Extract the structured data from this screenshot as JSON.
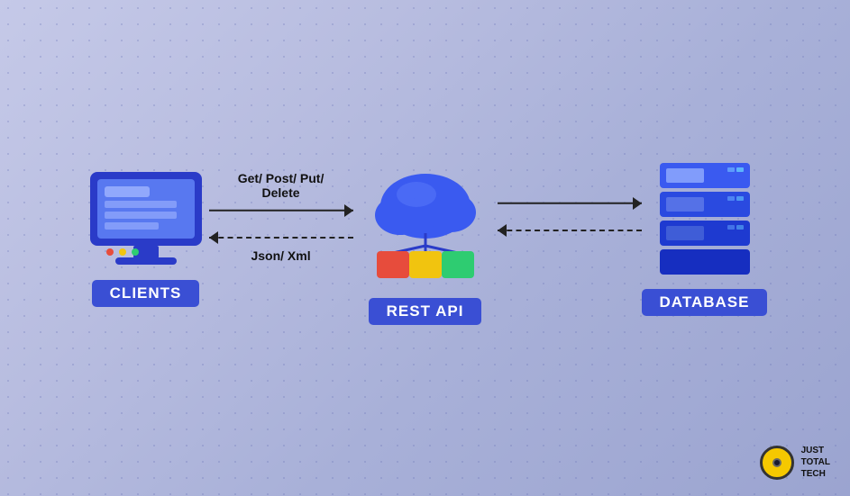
{
  "background": {
    "gradient_start": "#c5c9e8",
    "gradient_end": "#9ba4d0"
  },
  "diagram": {
    "clients": {
      "label": "CLIENTS"
    },
    "rest_api": {
      "label": "REST API"
    },
    "database": {
      "label": "DATABASE"
    },
    "arrow1": {
      "label": "Get/ Post/ Put/\nDelete",
      "direction": "right",
      "style": "solid"
    },
    "arrow2": {
      "label": "Json/ Xml",
      "direction": "left",
      "style": "dashed"
    },
    "arrow3": {
      "style": "solid",
      "direction": "right"
    },
    "arrow4": {
      "style": "dashed",
      "direction": "left"
    }
  },
  "logo": {
    "text": "JUST TOTAL TECH"
  }
}
